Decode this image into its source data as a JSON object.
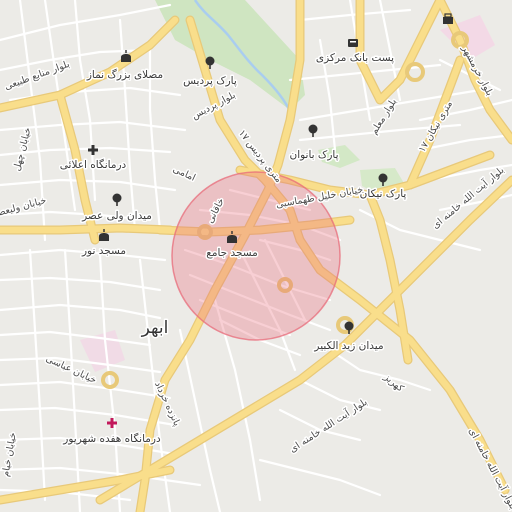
{
  "map": {
    "city_label": "ابهر",
    "circle_color": "#e86b7a",
    "pois": [
      {
        "id": "mosalla",
        "label": "مصلای بزرگ نماز",
        "icon": "mosque-icon"
      },
      {
        "id": "pardis",
        "label": "پارک پردیس",
        "icon": "tree-icon"
      },
      {
        "id": "post",
        "label": "پست بانک مرکزی",
        "icon": "bank-icon"
      },
      {
        "id": "banovan",
        "label": "پارک بانوان",
        "icon": "tree-icon"
      },
      {
        "id": "niikan",
        "label": "پارک نیکان",
        "icon": "tree-icon"
      },
      {
        "id": "alaei",
        "label": "درمانگاه اعلائی",
        "icon": "clinic-icon"
      },
      {
        "id": "valiasr",
        "label": "میدان ولی عصر",
        "icon": "tree-icon"
      },
      {
        "id": "noor",
        "label": "مسجد نور",
        "icon": "mosque-icon"
      },
      {
        "id": "jame",
        "label": "مسجد جامع",
        "icon": "mosque-icon"
      },
      {
        "id": "zeid",
        "label": "میدان زید الکبیر",
        "icon": "tree-icon"
      },
      {
        "id": "hefdah",
        "label": "درمانگاه هفده شهریور",
        "icon": "clinic-icon"
      }
    ],
    "roads": {
      "manabe": "بلوار منابع طبیعی",
      "pardis_blvd": "بلوار پردیس",
      "seventeen_a": "۱۷ متری پردیس",
      "khaghani": "خاقانی",
      "imami": "امامی",
      "khalil": "خیابان خلیل طهماسبی",
      "moalem": "بلوار معلم",
      "khorramshahr": "بلوار خرمشهر",
      "kh_khayyam": "خیابان خیام",
      "ayatollah_1": "بلوار آیت الله خامنه ای",
      "ayatollah_2": "بلوار آیت الله خامنه ای",
      "meydan_ayatollah": "بلوار آیت الله خامنه ای",
      "kahriz": "کهریز",
      "seventeen_b": "۱۷ متری نیکان",
      "abbasi": "خیابان عباسی",
      "pan": "پانزده خرداد",
      "vali_st": "خیابان ولیعصر",
      "chehel": "خیابان چهل"
    }
  }
}
